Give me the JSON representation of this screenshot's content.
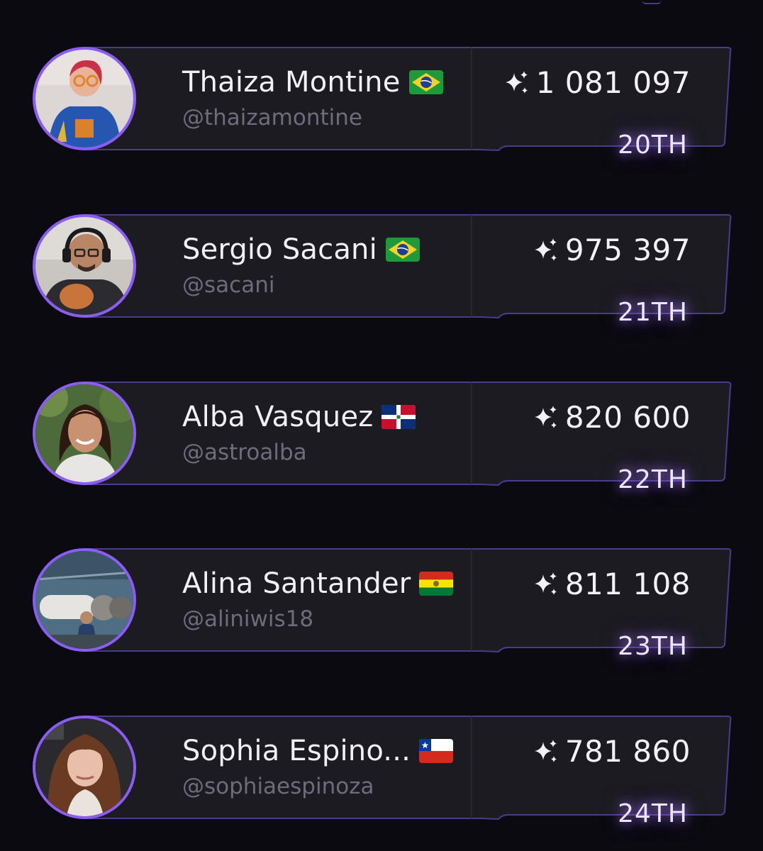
{
  "colors": {
    "accent": "#8b5cf6",
    "card": "#1c1b21",
    "card_border": "#4b3b8f",
    "text": "#f2f0f7",
    "muted": "#6f6b7a",
    "background": "#0b0a10"
  },
  "icons": {
    "score": "sparkles-icon"
  },
  "entries": [
    {
      "name": "Thaiza Montine",
      "handle": "@thaizamontine",
      "score": "1 081 097",
      "rank": "20TH",
      "flag": "brazil",
      "avatar": "woman-in-blue-flight-suit"
    },
    {
      "name": "Sergio Sacani",
      "handle": "@sacani",
      "score": "975 397",
      "rank": "21TH",
      "flag": "brazil",
      "avatar": "man-with-headphones"
    },
    {
      "name": "Alba Vasquez",
      "handle": "@astroalba",
      "score": "820 600",
      "rank": "22TH",
      "flag": "dominican-republic",
      "avatar": "woman-smiling-outdoors"
    },
    {
      "name": "Alina Santander",
      "handle": "@aliniwis18",
      "score": "811 108",
      "rank": "23TH",
      "flag": "bolivia",
      "avatar": "woman-near-rocket"
    },
    {
      "name": "Sophia Espino...",
      "handle": "@sophiaespinoza",
      "score": "781 860",
      "rank": "24TH",
      "flag": "chile",
      "avatar": "woman-with-long-hair"
    }
  ]
}
